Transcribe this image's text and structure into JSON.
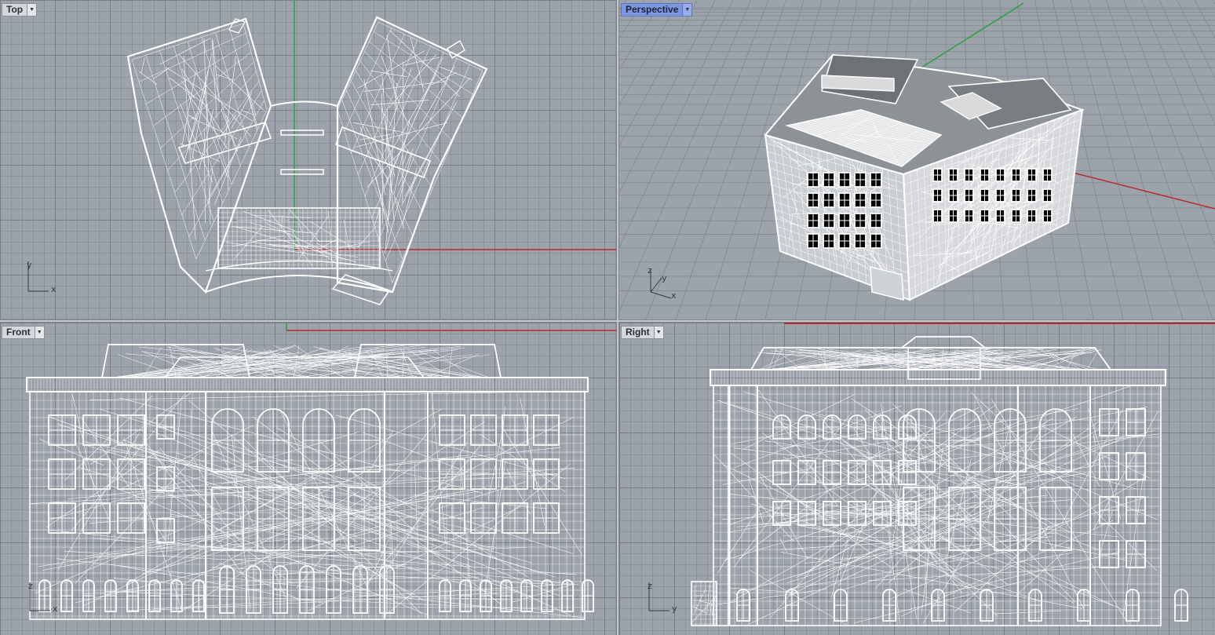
{
  "viewports": {
    "top": {
      "label": "Top",
      "axis_h": "x",
      "axis_v": "y"
    },
    "persp": {
      "label": "Perspective",
      "axis_1": "z",
      "axis_2": "y",
      "axis_3": "x"
    },
    "front": {
      "label": "Front",
      "axis_h": "x",
      "axis_v": "z"
    },
    "right": {
      "label": "Right",
      "axis_h": "y",
      "axis_v": "z"
    }
  },
  "icons": {
    "viewport_menu": "chevron-down-icon",
    "axis_indicator": "axis-indicator-icon"
  },
  "colors": {
    "viewport_background": "#9da3ab",
    "grid_line": "#7e848d",
    "wireframe": "#ffffff",
    "x_axis": "#b8292c",
    "y_axis": "#27a33d",
    "active_tab": "#7d96e2"
  }
}
